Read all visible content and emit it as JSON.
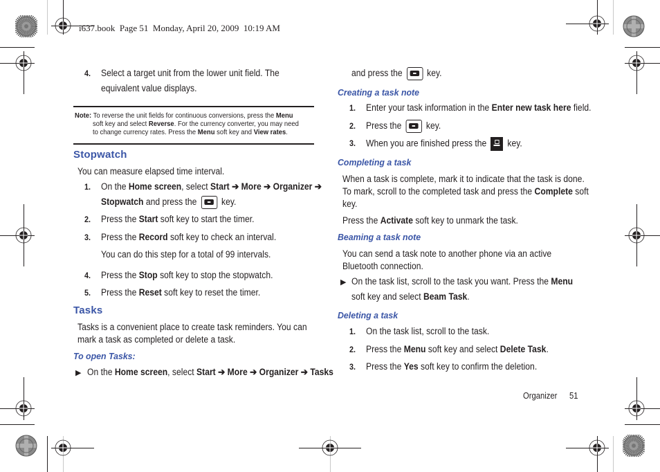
{
  "header": {
    "book_info": "i637.book  Page 51  Monday, April 20, 2009  10:19 AM"
  },
  "left_column": {
    "step4": {
      "number": "4.",
      "line1": "Select a target unit from the lower unit field. The",
      "line2": "equivalent value displays."
    },
    "note": {
      "label": "Note:",
      "line1_pre": "To reverse the unit fields for continuous conversions, press the ",
      "line1_bold": "Menu",
      "line2_pre": "soft key and select ",
      "line2_bold": "Reverse",
      "line2_post": ". For the currency converter, you may need",
      "line3_pre": "to change currency rates. Press the ",
      "line3_bold1": "Menu",
      "line3_mid": " soft key and ",
      "line3_bold2": "View rates",
      "line3_post": "."
    },
    "stopwatch": {
      "heading": "Stopwatch",
      "intro": "You can measure elapsed time interval.",
      "steps": [
        {
          "number": "1.",
          "pre": "On the ",
          "b1": "Home screen",
          "mid1": ", select ",
          "b2": "Start",
          "arrow": " ➔ ",
          "b3": "More",
          "b4": "Organizer",
          "l2_b": "Stopwatch",
          "l2_mid": " and press the ",
          "l2_post": " key."
        },
        {
          "number": "2.",
          "pre": "Press the ",
          "bold": "Start",
          "post": " soft key to start the timer."
        },
        {
          "number": "3.",
          "pre": "Press the ",
          "bold": "Record",
          "post": " soft key to check an interval.",
          "sub": "You can do this step for a total of 99 intervals."
        },
        {
          "number": "4.",
          "pre": "Press the ",
          "bold": "Stop",
          "post": " soft key to stop the stopwatch."
        },
        {
          "number": "5.",
          "pre": "Press the ",
          "bold": "Reset",
          "post": " soft key to reset the timer."
        }
      ]
    },
    "tasks": {
      "heading": "Tasks",
      "intro_line1": "Tasks is a convenient place to create task reminders. You can",
      "intro_line2": "mark a task as completed or delete a task.",
      "open_heading": "To open Tasks:",
      "open_step": {
        "bullet": "▶",
        "pre": "On the ",
        "b1": "Home screen",
        "mid": ", select ",
        "b2": "Start",
        "arrow": " ➔ ",
        "b3": "More",
        "b4": "Organizer",
        "b5": "Tasks"
      }
    }
  },
  "right_column": {
    "continued": {
      "pre": "and press the ",
      "post": " key."
    },
    "creating": {
      "heading": "Creating a task note",
      "steps": [
        {
          "number": "1.",
          "pre": "Enter your task information in the ",
          "bold": "Enter new task here",
          "post": " field."
        },
        {
          "number": "2.",
          "pre": "Press the ",
          "post": " key."
        },
        {
          "number": "3.",
          "pre": "When you are finished press the ",
          "post": " key."
        }
      ]
    },
    "completing": {
      "heading": "Completing a task",
      "line1": "When a task is complete, mark it to indicate that the task is done.",
      "line2_pre": "To mark, scroll to the completed task and press the ",
      "line2_bold": "Complete",
      "line2_post": " soft",
      "line3": "key.",
      "line4_pre": "Press the ",
      "line4_bold": "Activate",
      "line4_post": " soft key to unmark the task."
    },
    "beaming": {
      "heading": "Beaming a task note",
      "line1": "You can send a task note to another phone via an active",
      "line2": "Bluetooth connection.",
      "bullet": "▶",
      "step_pre": "On the task list, scroll to the task you want. Press the ",
      "step_bold": "Menu",
      "step_l2_pre": "soft key and select ",
      "step_l2_bold": "Beam Task",
      "step_l2_post": "."
    },
    "deleting": {
      "heading": "Deleting a task",
      "steps": [
        {
          "number": "1.",
          "text": "On the task list, scroll to the task."
        },
        {
          "number": "2.",
          "pre": "Press the ",
          "bold": "Menu",
          "mid": " soft key and select ",
          "bold2": "Delete Task",
          "post": "."
        },
        {
          "number": "3.",
          "pre": "Press the ",
          "bold": "Yes",
          "post": " soft key to confirm the deletion."
        }
      ]
    }
  },
  "footer": {
    "section": "Organizer",
    "page": "51"
  },
  "icons": {
    "select_key": "navigation-select-key-icon",
    "end_key": "end-power-key-icon",
    "registration_mark": "crosshair-registration-icon",
    "color_bar": "starburst-registration-icon"
  },
  "colors": {
    "heading": "#3a55a6",
    "text": "#231f20"
  }
}
